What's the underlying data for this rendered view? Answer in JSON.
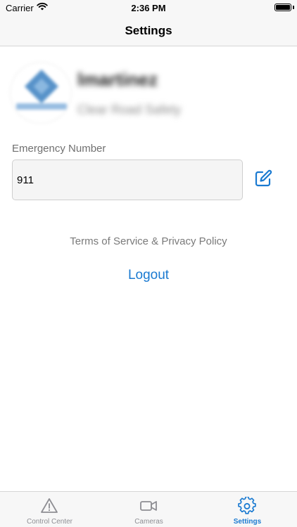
{
  "status_bar": {
    "carrier": "Carrier",
    "time": "2:36 PM"
  },
  "nav": {
    "title": "Settings"
  },
  "profile": {
    "username": "lmartinez",
    "subtitle": "Clear Road Safety"
  },
  "emergency": {
    "label": "Emergency Number",
    "value": "911"
  },
  "links": {
    "terms": "Terms of Service & Privacy Policy",
    "logout": "Logout"
  },
  "tabs": [
    {
      "label": "Control Center",
      "icon": "warning-icon",
      "active": false
    },
    {
      "label": "Cameras",
      "icon": "video-camera-icon",
      "active": false
    },
    {
      "label": "Settings",
      "icon": "gear-icon",
      "active": true
    }
  ],
  "colors": {
    "accent": "#1a7ad1",
    "inactive": "#8e8e93",
    "bar_background": "#f7f7f7"
  }
}
